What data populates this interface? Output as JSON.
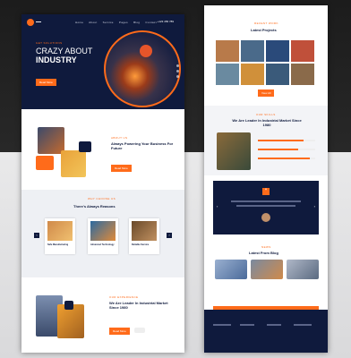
{
  "left_page": {
    "nav": {
      "links": [
        "Home",
        "About",
        "Service",
        "Pages",
        "Blog",
        "Contact"
      ],
      "phone": "+123 456 789"
    },
    "hero": {
      "kicker": "GET SOLUTIONS",
      "title_line1": "CRAZY ABOUT",
      "title_line2": "INDUSTRY",
      "button": "Read More"
    },
    "about": {
      "kicker": "ABOUT US",
      "title": "Always Powering Your Business For Future",
      "button": "Read More"
    },
    "reasons": {
      "kicker": "WHY CHOOSE US",
      "title": "There's Always Reasons",
      "cards": [
        "Safe Manufacturing",
        "Advanced Technology",
        "Reliable Service"
      ]
    },
    "leader": {
      "kicker": "OUR EXPERIENCE",
      "title": "We Are Leader In Industrial Market Since 1980",
      "button": "Read More"
    }
  },
  "right_page": {
    "projects": {
      "kicker": "RECENT WORK",
      "title": "Latest Projects",
      "button": "View All"
    },
    "leader": {
      "kicker": "OUR SKILLS",
      "title": "We Are Leader In Industrial Market Since 1980"
    },
    "testimonial": {
      "quote_icon": "quote-icon"
    },
    "blog": {
      "kicker": "NEWS",
      "title": "Latest From Blog"
    }
  },
  "colors": {
    "navy": "#0f1a3d",
    "accent": "#ff6b1a"
  }
}
